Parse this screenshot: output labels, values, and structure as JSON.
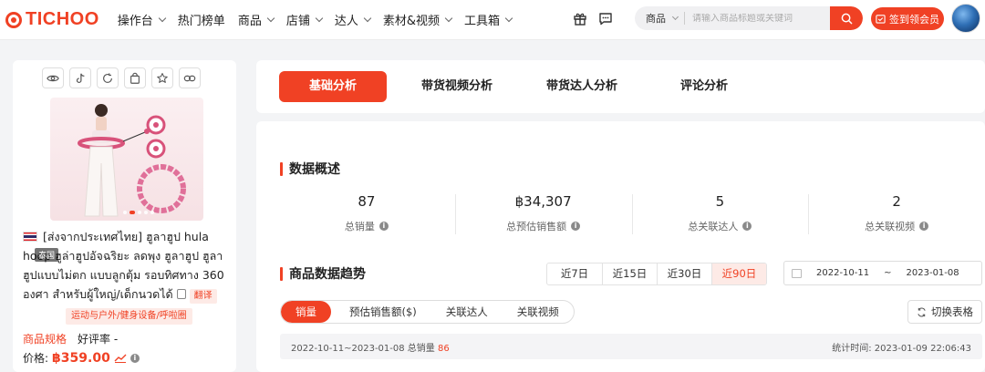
{
  "brand": {
    "name": "TICHOO"
  },
  "nav": {
    "items": [
      {
        "label": "操作台",
        "dropdown": true
      },
      {
        "label": "热门榜单",
        "dropdown": false
      },
      {
        "label": "商品",
        "dropdown": true
      },
      {
        "label": "店铺",
        "dropdown": true
      },
      {
        "label": "达人",
        "dropdown": true
      },
      {
        "label": "素材&视频",
        "dropdown": true
      },
      {
        "label": "工具箱",
        "dropdown": true
      }
    ]
  },
  "search": {
    "category": "商品",
    "placeholder": "请输入商品标题或关键词"
  },
  "vip_button": {
    "label": "签到领会员"
  },
  "product": {
    "country_tag": "泰国",
    "title": "[ส่งจากประเทศไทย] ฮูลาฮูป hula hoop ฮูล่าฮูปอัจฉริยะ ลดพุง ฮูลาฮูป ฮูลาฮูปแบบไม่ตก แบบลูกตุ้ม รอบทิศทาง 360 องศา สำหรับผู้ใหญ่/เด็กนวดได้",
    "translate_label": "翻译",
    "category_tag": "运动与户外/健身设备/呼啦圈",
    "spec_label": "商品规格",
    "rating_label": "好评率 -",
    "price_label": "价格:",
    "price": "฿359.00"
  },
  "tabs": [
    {
      "label": "基础分析",
      "active": true
    },
    {
      "label": "带货视频分析",
      "active": false
    },
    {
      "label": "带货达人分析",
      "active": false
    },
    {
      "label": "评论分析",
      "active": false
    }
  ],
  "overview": {
    "title": "数据概述",
    "stats": [
      {
        "value": "87",
        "label": "总销量"
      },
      {
        "value": "฿34,307",
        "label": "总预估销售额"
      },
      {
        "value": "5",
        "label": "总关联达人"
      },
      {
        "value": "2",
        "label": "总关联视频"
      }
    ]
  },
  "trend": {
    "title": "商品数据趋势",
    "ranges": [
      {
        "label": "近7日",
        "active": false
      },
      {
        "label": "近15日",
        "active": false
      },
      {
        "label": "近30日",
        "active": false
      },
      {
        "label": "近90日",
        "active": true
      }
    ],
    "date_start": "2022-10-11",
    "date_sep": "~",
    "date_end": "2023-01-08",
    "metrics": [
      {
        "label": "销量",
        "active": true
      },
      {
        "label": "预估销售额($)",
        "active": false
      },
      {
        "label": "关联达人",
        "active": false
      },
      {
        "label": "关联视频",
        "active": false
      }
    ],
    "switch_label": "切换表格",
    "summary_range": "2022-10-11~2023-01-08 总销量",
    "summary_value": "86",
    "stat_time_label": "统计时间:",
    "stat_time_value": "2023-01-09 22:06:43"
  },
  "colors": {
    "accent": "#f04124",
    "accent_light": "#fdeae6"
  }
}
